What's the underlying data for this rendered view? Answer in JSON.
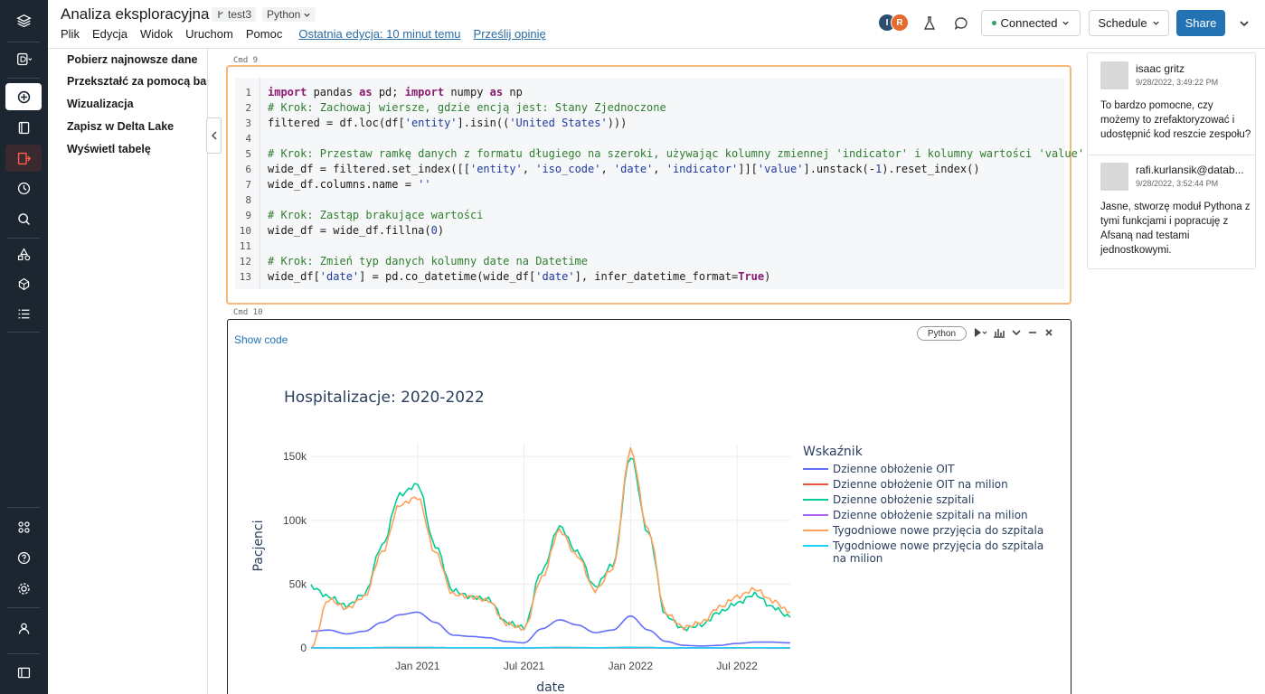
{
  "header": {
    "title": "Analiza eksploracyjna",
    "branch": "test3",
    "language": "Python",
    "menu": [
      "Plik",
      "Edycja",
      "Widok",
      "Uruchom",
      "Pomoc"
    ],
    "last_edit": "Ostatnia edycja: 10 minut temu",
    "feedback": "Prześlij opinię",
    "avatars": [
      "I",
      "R"
    ],
    "connected": "Connected",
    "schedule": "Schedule",
    "share": "Share"
  },
  "toc": {
    "items": [
      "Pobierz najnowsze dane",
      "Przekształć za pomocą bamboolib",
      "Wizualizacja",
      "Zapisz w Delta Lake",
      "Wyświetl tabelę"
    ]
  },
  "cells": [
    {
      "label": "Cmd 9",
      "lines": [
        "import pandas as pd; import numpy as np",
        "# Krok: Zachowaj wiersze, gdzie encją jest: Stany Zjednoczone",
        "filtered = df.loc(df['entity'].isin(('United States')))",
        "",
        "# Krok: Przestaw ramkę danych z formatu długiego na szeroki, używając kolumny zmiennej 'indicator' i kolumny wartości 'value'",
        "wide_df = filtered.set_index([['entity', 'iso_code', 'date', 'indicator']]['value'].unstack(-1).reset_index()",
        "wide_df.columns.name = ''",
        "",
        "# Krok: Zastąp brakujące wartości",
        "wide_df = wide_df.fillna(0)",
        "",
        "# Krok: Zmień typ danych kolumny date na Datetime",
        "wide_df['date'] = pd.co_datetime(wide_df['date'], infer_datetime_format=True)"
      ]
    },
    {
      "label": "Cmd 10",
      "show_code": "Show code",
      "language": "Python"
    }
  ],
  "chart_data": {
    "type": "line",
    "title": "Hospitalizacje: 2020-2022",
    "xlabel": "date",
    "ylabel": "Pacjenci",
    "x_ticks": [
      "Jan 2021",
      "Jul 2021",
      "Jan 2022",
      "Jul 2022"
    ],
    "y_ticks": [
      "0",
      "50k",
      "100k",
      "150k"
    ],
    "ylim": [
      0,
      160000
    ],
    "x": [
      "2020-07",
      "2020-08",
      "2020-09",
      "2020-10",
      "2020-11",
      "2020-12",
      "2021-01",
      "2021-02",
      "2021-03",
      "2021-04",
      "2021-05",
      "2021-06",
      "2021-07",
      "2021-08",
      "2021-09",
      "2021-10",
      "2021-11",
      "2021-12",
      "2022-01",
      "2022-02",
      "2022-03",
      "2022-04",
      "2022-05",
      "2022-06",
      "2022-07",
      "2022-08",
      "2022-09",
      "2022-10"
    ],
    "legend_title": "Wskaźnik",
    "legend_position": "right",
    "grid": true,
    "series": [
      {
        "name": "Dzienne obłożenie OIT",
        "color": "#636efa",
        "values": [
          13000,
          14000,
          11000,
          13000,
          20000,
          26000,
          28000,
          20000,
          10000,
          9000,
          8000,
          5000,
          4000,
          15000,
          22000,
          18000,
          12000,
          14000,
          25000,
          14000,
          5000,
          2000,
          1500,
          2000,
          3500,
          4500,
          4500,
          4000
        ]
      },
      {
        "name": "Dzienne obłożenie OIT na milion",
        "color": "#ef553b",
        "values": [
          40,
          42,
          33,
          40,
          60,
          78,
          85,
          60,
          30,
          27,
          24,
          15,
          12,
          45,
          66,
          54,
          36,
          42,
          75,
          42,
          15,
          6,
          5,
          6,
          11,
          14,
          14,
          12
        ]
      },
      {
        "name": "Dzienne obłożenie szpitali",
        "color": "#00cc96",
        "values": [
          48000,
          40000,
          33000,
          42000,
          80000,
          120000,
          128000,
          80000,
          45000,
          40000,
          38000,
          20000,
          16000,
          60000,
          95000,
          75000,
          48000,
          65000,
          150000,
          90000,
          25000,
          15000,
          18000,
          28000,
          35000,
          42000,
          32000,
          24000
        ]
      },
      {
        "name": "Dzienne obłożenie szpitali na milion",
        "color": "#ab63fa",
        "values": [
          145,
          121,
          100,
          127,
          242,
          363,
          388,
          242,
          136,
          121,
          115,
          61,
          48,
          182,
          288,
          227,
          145,
          197,
          454,
          273,
          76,
          45,
          55,
          85,
          106,
          127,
          97,
          73
        ]
      },
      {
        "name": "Tygodniowe nowe przyjęcia do szpitala",
        "color": "#ffa15a",
        "values": [
          0,
          38000,
          31000,
          40000,
          75000,
          112000,
          118000,
          75000,
          42000,
          40000,
          37000,
          19000,
          15000,
          55000,
          92000,
          72000,
          45000,
          62000,
          155000,
          92000,
          27000,
          16000,
          20000,
          32000,
          40000,
          46000,
          37000,
          28000
        ]
      },
      {
        "name": "Tygodniowe nowe przyjęcia do szpitala na milion",
        "color": "#19d3f3",
        "values": [
          0,
          115,
          94,
          121,
          227,
          339,
          357,
          227,
          127,
          121,
          112,
          58,
          45,
          167,
          279,
          218,
          136,
          188,
          470,
          279,
          82,
          48,
          61,
          97,
          121,
          139,
          112,
          85
        ]
      }
    ]
  },
  "comments": [
    {
      "author": "isaac gritz",
      "time": "9/28/2022, 3:49:22 PM",
      "text": "To bardzo pomocne, czy możemy to zrefaktoryzować i udostępnić kod reszcie zespołu?"
    },
    {
      "author": "rafi.kurlansik@datab...",
      "time": "9/28/2022, 3:52:44 PM",
      "text": "Jasne, stworzę moduł Pythona z tymi funkcjami i popracuję z Afsaną nad testami jednostkowymi."
    }
  ]
}
